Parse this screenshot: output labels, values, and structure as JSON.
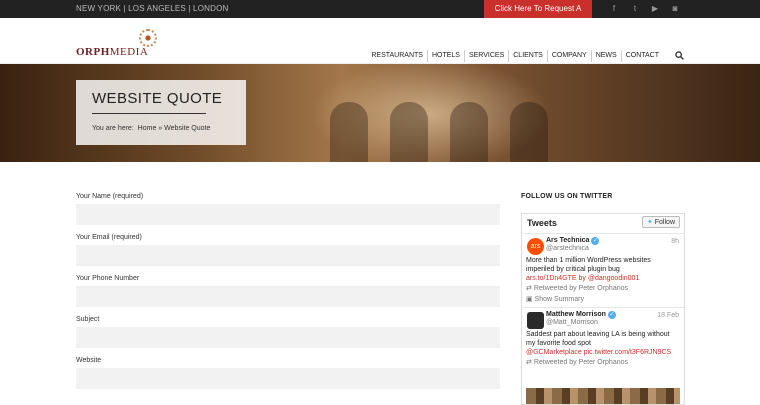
{
  "topbar": {
    "locations": "NEW YORK | LOS ANGELES | LONDON",
    "cta": "Click Here To Request A Quote",
    "social": [
      {
        "icon": "facebook-icon",
        "glyph": "f"
      },
      {
        "icon": "twitter-icon",
        "glyph": "t"
      },
      {
        "icon": "youtube-icon",
        "glyph": "▶"
      },
      {
        "icon": "instagram-icon",
        "glyph": "◙"
      }
    ]
  },
  "header": {
    "logo_bold": "ORPH",
    "logo_rest": "MEDIA",
    "nav": [
      "RESTAURANTS",
      "HOTELS",
      "SERVICES",
      "CLIENTS",
      "COMPANY",
      "NEWS",
      "CONTACT"
    ],
    "search_icon": "search-icon"
  },
  "hero": {
    "title": "WEBSITE QUOTE",
    "breadcrumb_prefix": "You are here:",
    "breadcrumb_home": "Home",
    "breadcrumb_sep": "»",
    "breadcrumb_current": "Website Quote"
  },
  "form": {
    "fields": [
      {
        "label": "Your Name (required)",
        "value": ""
      },
      {
        "label": "Your Email (required)",
        "value": ""
      },
      {
        "label": "Your Phone Number",
        "value": ""
      },
      {
        "label": "Subject",
        "value": ""
      },
      {
        "label": "Website",
        "value": ""
      }
    ]
  },
  "sidebar": {
    "heading": "FOLLOW US ON TWITTER",
    "widget_title": "Tweets",
    "follow_label": "Follow",
    "tweets": [
      {
        "name": "Ars Technica",
        "handle": "@arstechnica",
        "time": "8h",
        "text": "More than 1 million WordPress websites imperiled by critical plugin bug",
        "links": "ars.to/1Dn4GTE by @dangoodin001",
        "retweet": "Retweeted by Peter Orphanos",
        "summary": "Show Summary",
        "avatar_color": "#ff4e00",
        "avatar_text": "ars"
      },
      {
        "name": "Matthew Morrison",
        "handle": "@Matt_Morrison",
        "time": "18 Feb",
        "text": "Saddest part about leaving LA is being without my favorite food spot",
        "links": "@GCMarketplace pic.twitter.com/t3F6RJN9CS",
        "retweet": "Retweeted by Peter Orphanos",
        "avatar_color": "#2a2a2a"
      }
    ]
  },
  "colors": {
    "accent": "#c9302c",
    "topbar": "#222222"
  }
}
